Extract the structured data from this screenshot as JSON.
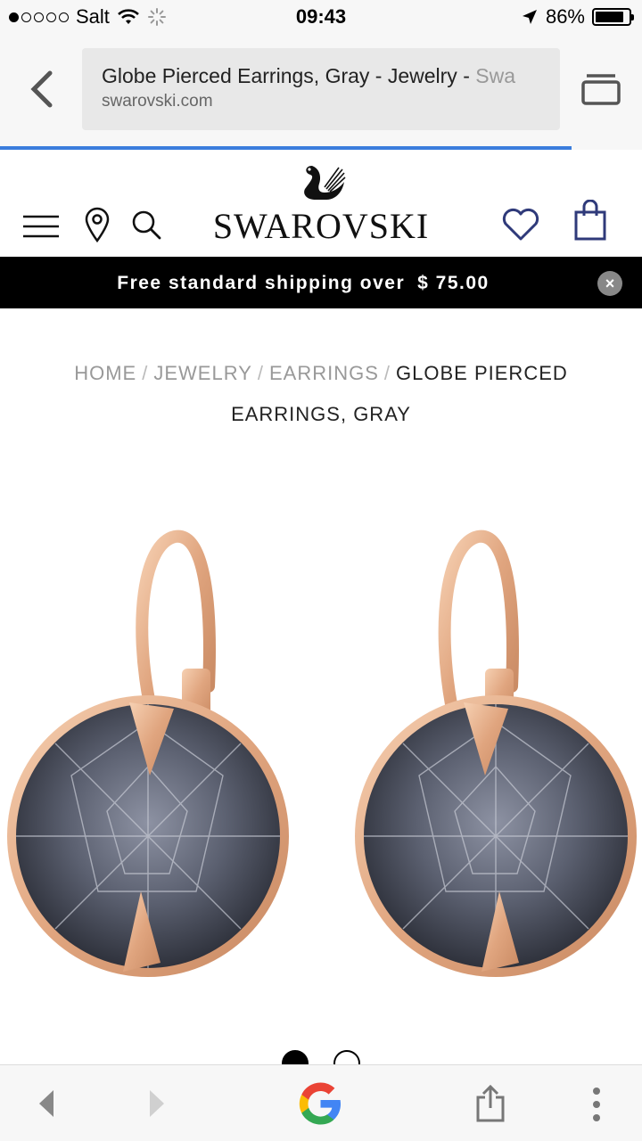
{
  "status_bar": {
    "carrier": "Salt",
    "time": "09:43",
    "battery": "86%",
    "battery_level": 0.86
  },
  "browser": {
    "page_title": "Globe Pierced Earrings, Gray - Jewelry - ",
    "page_title_faded": "Swa",
    "domain": "swarovski.com",
    "load_progress": 0.89
  },
  "header": {
    "brand": "SWAROVSKI"
  },
  "banner": {
    "text": "Free standard shipping over",
    "amount": "$ 75.00",
    "close": "×"
  },
  "breadcrumb": {
    "home": "HOME",
    "jewelry": "JEWELRY",
    "earrings": "EARRINGS",
    "current": "GLOBE PIERCED EARRINGS, GRAY",
    "separator": "/"
  },
  "carousel": {
    "count": 2,
    "active_index": 0
  },
  "colors": {
    "accent": "#3b7ddd",
    "heart_bag": "#2f3a7a",
    "rose_gold": "#e7b08c",
    "crystal": "#5b6070"
  }
}
